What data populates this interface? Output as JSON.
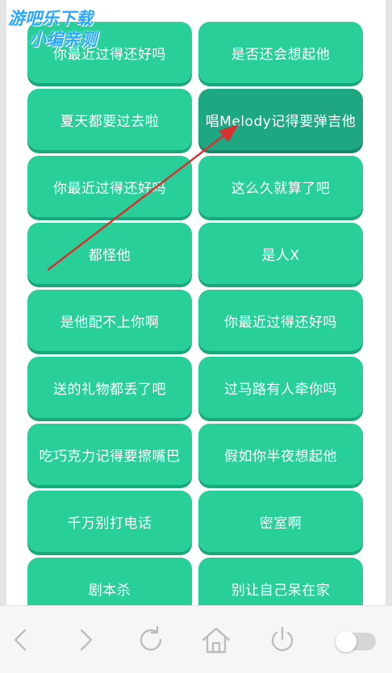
{
  "watermark": {
    "line1": "游吧乐下载",
    "line2": "小编亲测"
  },
  "buttons": [
    {
      "label": "你最近过得还好吗"
    },
    {
      "label": "是否还会想起他"
    },
    {
      "label": "夏天都要过去啦"
    },
    {
      "label": "唱Melody记得要弹吉他",
      "active": true
    },
    {
      "label": "你最近过得还好吗"
    },
    {
      "label": "这么久就算了吧"
    },
    {
      "label": "都怪他"
    },
    {
      "label": "是人X"
    },
    {
      "label": "是他配不上你啊"
    },
    {
      "label": "你最近过得还好吗"
    },
    {
      "label": "送的礼物都丢了吧"
    },
    {
      "label": "过马路有人牵你吗"
    },
    {
      "label": "吃巧克力记得要擦嘴巴"
    },
    {
      "label": "假如你半夜想起他"
    },
    {
      "label": "千万别打电话"
    },
    {
      "label": "密室啊"
    },
    {
      "label": "剧本杀"
    },
    {
      "label": "别让自己呆在家"
    }
  ],
  "colors": {
    "button": "#28cf98",
    "button_active": "#1ea882",
    "annotation_arrow": "#d93030"
  },
  "nav": {
    "items": [
      "back-icon",
      "forward-icon",
      "refresh-icon",
      "home-icon",
      "power-icon"
    ],
    "toggle_on": false
  }
}
